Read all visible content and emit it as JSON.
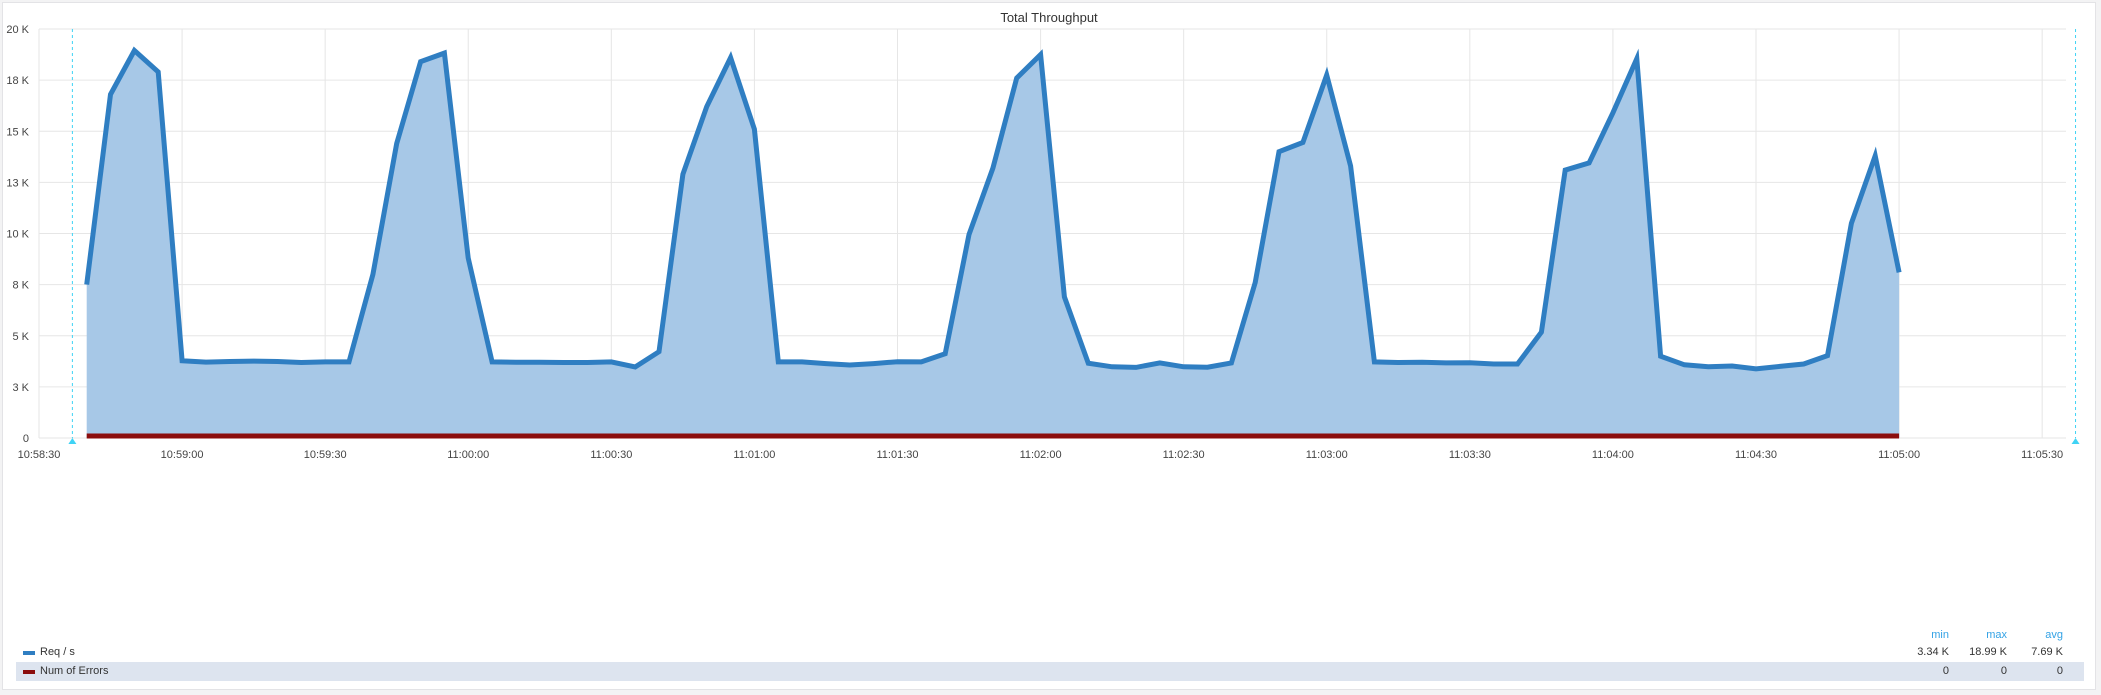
{
  "chart_data": {
    "type": "area",
    "title": "Total Throughput",
    "x_start": "10:58:40",
    "x_step_seconds": 5,
    "x_ticks": [
      "10:58:30",
      "10:59:00",
      "10:59:30",
      "11:00:00",
      "11:00:30",
      "11:01:00",
      "11:01:30",
      "11:02:00",
      "11:02:30",
      "11:03:00",
      "11:03:30",
      "11:04:00",
      "11:04:30",
      "11:05:00",
      "11:05:30"
    ],
    "x_range": [
      "10:58:30",
      "11:05:35"
    ],
    "y_ticks": [
      "0",
      "3 K",
      "5 K",
      "8 K",
      "10 K",
      "13 K",
      "15 K",
      "18 K",
      "20 K"
    ],
    "ylim": [
      0,
      20000
    ],
    "grid": true,
    "legend_placement": "bottom",
    "legend_columns": [
      "min",
      "max",
      "avg"
    ],
    "series": [
      {
        "name": "Req / s",
        "color": "#2f7ec2",
        "fill": "#a7c8e7",
        "values": [
          7500,
          16800,
          18950,
          17900,
          3780,
          3710,
          3740,
          3760,
          3740,
          3690,
          3720,
          3720,
          8000,
          14400,
          18400,
          18820,
          8800,
          3720,
          3700,
          3700,
          3690,
          3690,
          3720,
          3470,
          4220,
          12900,
          16200,
          18600,
          15100,
          3720,
          3720,
          3640,
          3570,
          3640,
          3730,
          3720,
          4120,
          9950,
          13200,
          17600,
          18750,
          6900,
          3660,
          3480,
          3450,
          3670,
          3480,
          3460,
          3670,
          7600,
          14000,
          14450,
          17750,
          13300,
          3720,
          3690,
          3700,
          3670,
          3680,
          3620,
          3620,
          5180,
          13100,
          13450,
          15900,
          18550,
          4000,
          3580,
          3480,
          3520,
          3380,
          3500,
          3620,
          4030,
          10500,
          13800,
          8100
        ],
        "stats": {
          "min": "3.34 K",
          "max": "18.99 K",
          "avg": "7.69 K"
        }
      },
      {
        "name": "Num of Errors",
        "color": "#8b0d0d",
        "values": [
          0,
          0,
          0,
          0,
          0,
          0,
          0,
          0,
          0,
          0,
          0,
          0,
          0,
          0,
          0,
          0,
          0,
          0,
          0,
          0,
          0,
          0,
          0,
          0,
          0,
          0,
          0,
          0,
          0,
          0,
          0,
          0,
          0,
          0,
          0,
          0,
          0,
          0,
          0,
          0,
          0,
          0,
          0,
          0,
          0,
          0,
          0,
          0,
          0,
          0,
          0,
          0,
          0,
          0,
          0,
          0,
          0,
          0,
          0,
          0,
          0,
          0,
          0,
          0,
          0,
          0,
          0,
          0,
          0,
          0,
          0,
          0,
          0,
          0,
          0,
          0,
          0
        ],
        "stats": {
          "min": "0",
          "max": "0",
          "avg": "0"
        }
      }
    ],
    "markers": [
      "10:58:37",
      "11:05:37"
    ],
    "marker_color": "#3fd3f5"
  }
}
